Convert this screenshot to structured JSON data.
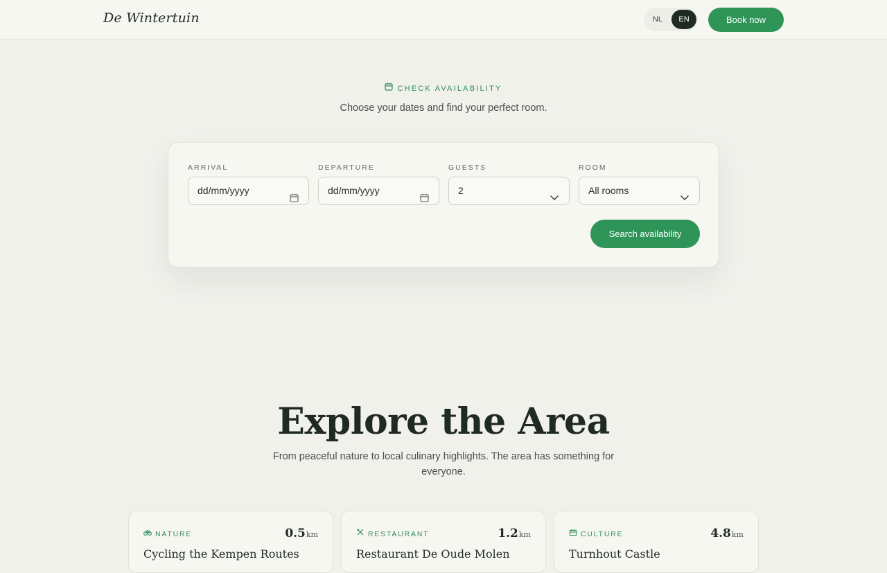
{
  "header": {
    "brand": "De Wintertuin",
    "languages": [
      "NL",
      "EN"
    ],
    "active_language": "EN",
    "book_label": "Book now"
  },
  "availability": {
    "eyebrow": "CHECK AVAILABILITY",
    "subtitle": "Choose your dates and find your perfect room.",
    "fields": {
      "arrival": {
        "label": "ARRIVAL",
        "value": "dd/mm/yyyy"
      },
      "departure": {
        "label": "DEPARTURE",
        "value": "dd/mm/yyyy"
      },
      "guests": {
        "label": "GUESTS",
        "value": "2"
      },
      "room": {
        "label": "ROOM",
        "value": "All rooms"
      }
    },
    "search_label": "Search availability"
  },
  "explore": {
    "title": "Explore the Area",
    "subtitle": "From peaceful nature to local culinary highlights. The area has something for everyone.",
    "cards": [
      {
        "category": "NATURE",
        "icon": "bike-icon",
        "distance": "0.5",
        "unit": "km",
        "title": "Cycling the Kempen Routes"
      },
      {
        "category": "RESTAURANT",
        "icon": "utensils-icon",
        "distance": "1.2",
        "unit": "km",
        "title": "Restaurant De Oude Molen"
      },
      {
        "category": "CULTURE",
        "icon": "castle-icon",
        "distance": "4.8",
        "unit": "km",
        "title": "Turnhout Castle"
      }
    ]
  },
  "colors": {
    "accent": "#2e9457",
    "accent_text": "#2e8a55",
    "dark": "#1f2a22",
    "background": "#f1f1ec"
  }
}
